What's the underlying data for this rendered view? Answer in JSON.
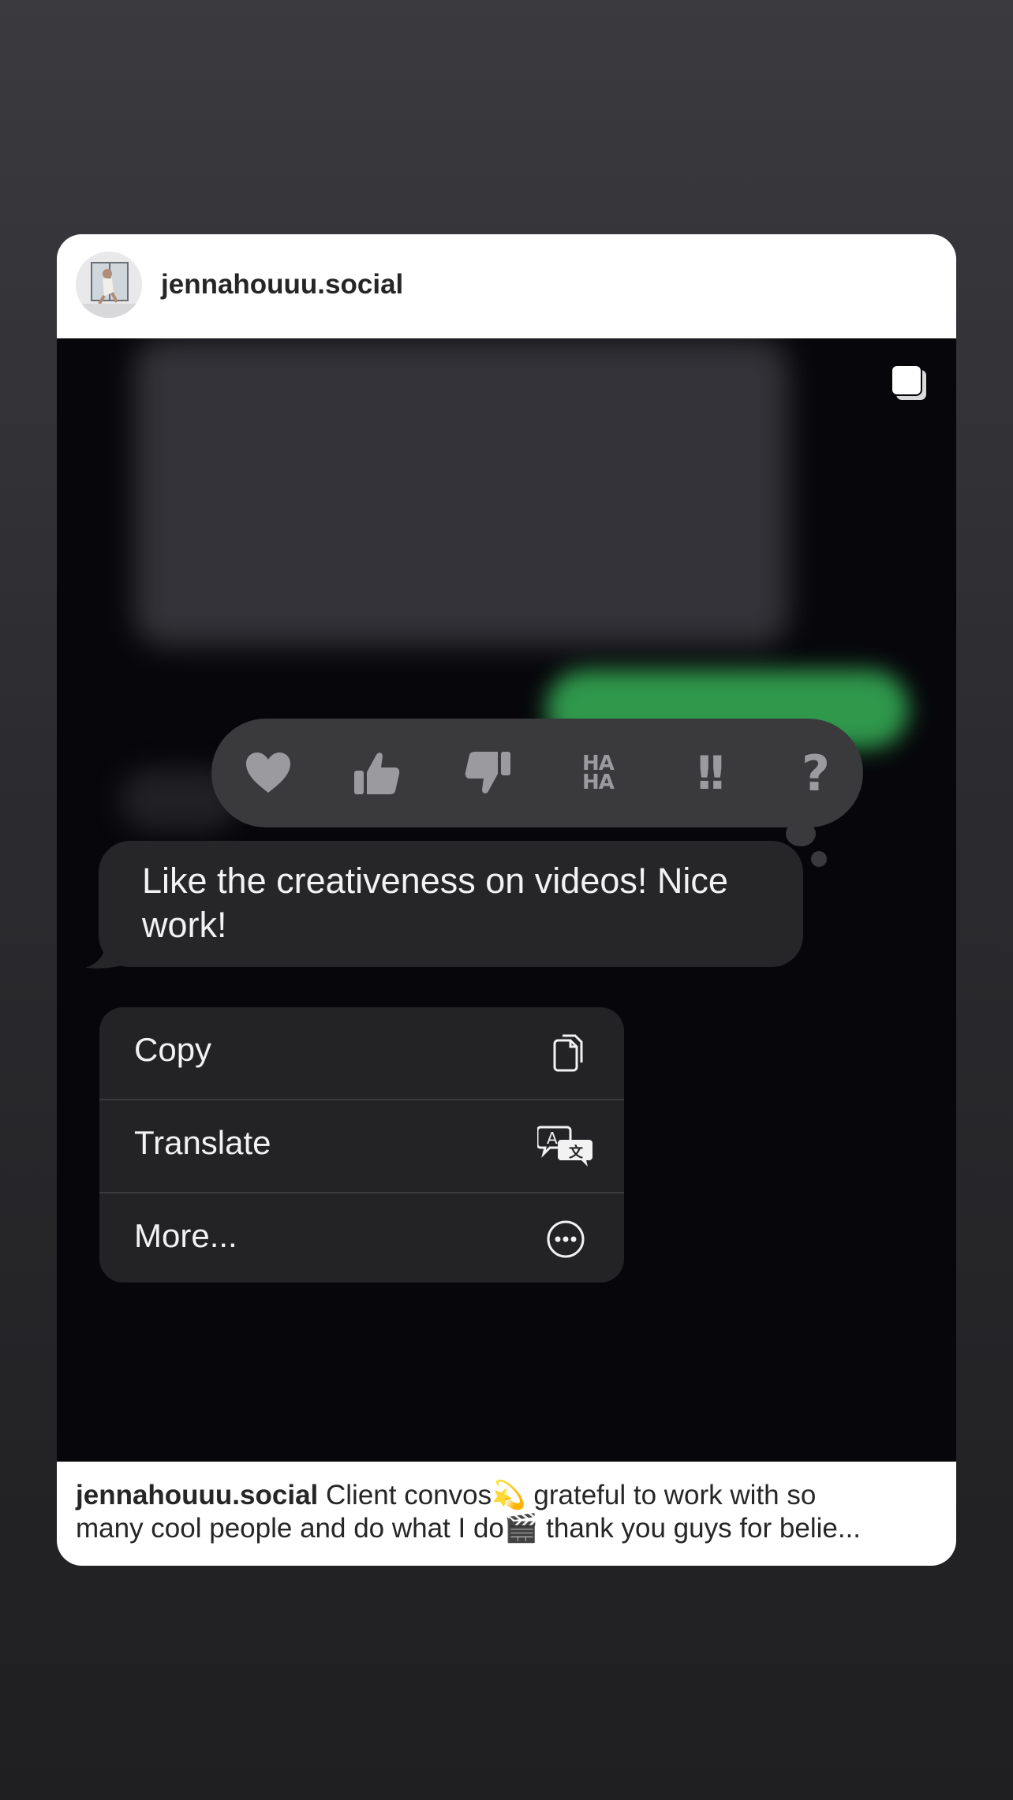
{
  "post": {
    "username": "jennahouuu.social",
    "caption_user": "jennahouuu.social",
    "caption_line1": " Client convos💫 grateful to work with so",
    "caption_line2": "many cool people and do what I do🎬 thank you guys for belie..."
  },
  "reactions": {
    "heart": "heart-icon",
    "thumbs_up": "thumbs-up-icon",
    "thumbs_down": "thumbs-down-icon",
    "haha_top": "HA",
    "haha_bottom": "HA",
    "emphasize": "!!",
    "question": "?"
  },
  "message": {
    "text": "Like the creativeness on videos! Nice work!"
  },
  "menu": {
    "items": [
      {
        "label": "Copy",
        "icon": "copy-icon"
      },
      {
        "label": "Translate",
        "icon": "translate-icon"
      },
      {
        "label": "More...",
        "icon": "more-icon"
      }
    ]
  },
  "colors": {
    "background_top": "#3a3a3f",
    "card": "#ffffff",
    "media_bg": "#07070b",
    "bubble": "#262628",
    "tapback": "#3a3a3d",
    "accent_green": "#34a853"
  }
}
